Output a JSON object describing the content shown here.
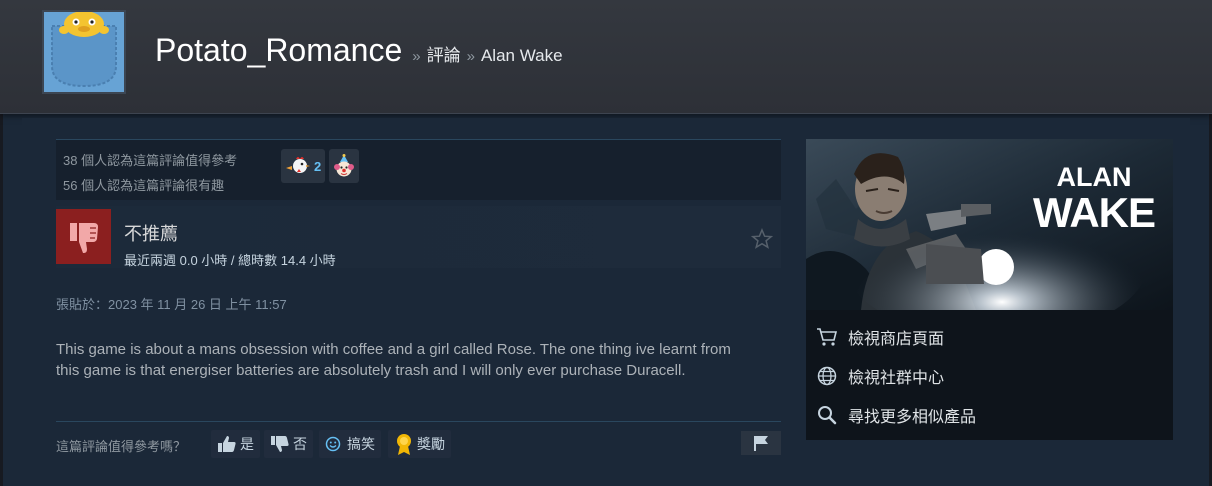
{
  "profile": {
    "persona_name": "Potato_Romance",
    "breadcrumb_sep_1": "»",
    "breadcrumb_reviews": "評論",
    "breadcrumb_sep_2": "»",
    "breadcrumb_game": "Alan Wake"
  },
  "votes": {
    "helpful_text": "38 個人認為這篇評論值得參考",
    "funny_text": "56 個人認為這篇評論很有趣",
    "awards": [
      {
        "icon": "chicken-award-icon",
        "count": "2"
      },
      {
        "icon": "clown-award-icon",
        "count": ""
      }
    ]
  },
  "review": {
    "recommendation": "不推薦",
    "hours": "最近兩週 0.0 小時 / 總時數 14.4 小時",
    "posted": "張貼於：2023 年 11 月 26 日 上午 11:57",
    "body": "This game is about a mans obsession with coffee and a girl called Rose. The one thing ive learnt from this game is that energiser batteries are absolutely trash and I will only ever purchase Duracell."
  },
  "feedback": {
    "question": "這篇評論值得參考嗎？",
    "yes_label": "是",
    "no_label": "否",
    "funny_label": "搞笑",
    "award_label": "獎勵"
  },
  "game": {
    "art_title_line1": "ALAN",
    "art_title_line2": "WAKE",
    "store_label": "檢視商店頁面",
    "community_label": "檢視社群中心",
    "similar_label": "尋找更多相似產品"
  },
  "colors": {
    "background": "#1b2838",
    "header": "#2d3037",
    "thumb_down": "#8b1f1f",
    "accent_blue": "#66c0f4"
  }
}
